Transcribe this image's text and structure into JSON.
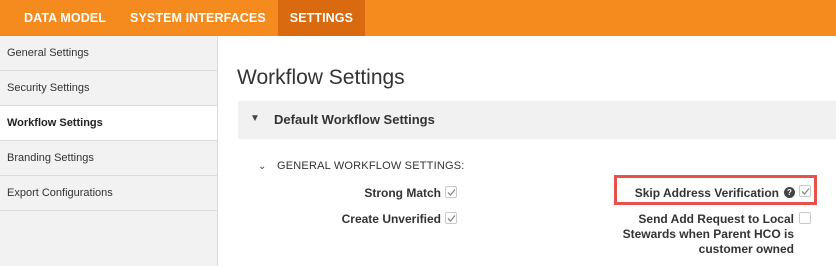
{
  "topnav": {
    "items": [
      {
        "label": "DATA MODEL"
      },
      {
        "label": "SYSTEM INTERFACES"
      },
      {
        "label": "SETTINGS"
      }
    ],
    "active_index": 2,
    "brand_color": "#f58a1f",
    "active_color": "#d96a0f"
  },
  "sidebar": {
    "items": [
      {
        "label": "General Settings"
      },
      {
        "label": "Security Settings"
      },
      {
        "label": "Workflow Settings"
      },
      {
        "label": "Branding Settings"
      },
      {
        "label": "Export Configurations"
      }
    ],
    "active_index": 2
  },
  "main": {
    "title": "Workflow Settings",
    "section": {
      "title": "Default Workflow Settings",
      "subsection": "GENERAL WORKFLOW SETTINGS:",
      "fields": {
        "strong_match": {
          "label": "Strong Match",
          "checked": true
        },
        "create_unverified": {
          "label": "Create Unverified",
          "checked": true
        },
        "skip_address_verification": {
          "label": "Skip Address Verification",
          "checked": true,
          "highlight_color": "#e8504a"
        },
        "send_add_request": {
          "label_lines": [
            "Send Add Request to Local",
            "Stewards when Parent HCO is",
            "customer owned"
          ],
          "checked": false
        }
      }
    }
  }
}
